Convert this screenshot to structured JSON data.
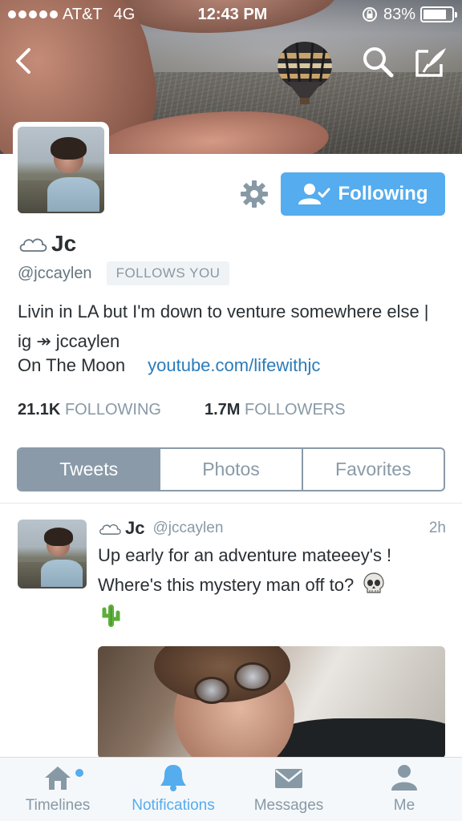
{
  "status_bar": {
    "carrier": "AT&T",
    "network": "4G",
    "time": "12:43 PM",
    "battery": "83%",
    "battery_level": 0.83
  },
  "profile": {
    "name": "Jc",
    "handle": "@jccaylen",
    "follows_you": "FOLLOWS YOU",
    "bio": "Livin in LA but I'm down to venture somewhere else | ig ↠ jccaylen",
    "location": "On The Moon",
    "url": "youtube.com/lifewithjc",
    "following_count": "21.1K",
    "following_label": "FOLLOWING",
    "followers_count": "1.7M",
    "followers_label": "FOLLOWERS",
    "follow_button_label": "Following"
  },
  "profile_tabs": [
    {
      "label": "Tweets",
      "active": true
    },
    {
      "label": "Photos",
      "active": false
    },
    {
      "label": "Favorites",
      "active": false
    }
  ],
  "tweet": {
    "name": "Jc",
    "handle": "@jccaylen",
    "time": "2h",
    "text": "Up early for an adventure mateeey's ! Where's this mystery man off to?"
  },
  "tabbar": [
    {
      "label": "Timelines",
      "icon": "home-icon",
      "active": false
    },
    {
      "label": "Notifications",
      "icon": "bell-icon",
      "active": true
    },
    {
      "label": "Messages",
      "icon": "envelope-icon",
      "active": false
    },
    {
      "label": "Me",
      "icon": "person-icon",
      "active": false
    }
  ],
  "colors": {
    "accent": "#55acee",
    "link": "#2b7bb9",
    "tab_active_bg": "#8a9aa8",
    "muted": "#8899a6"
  }
}
